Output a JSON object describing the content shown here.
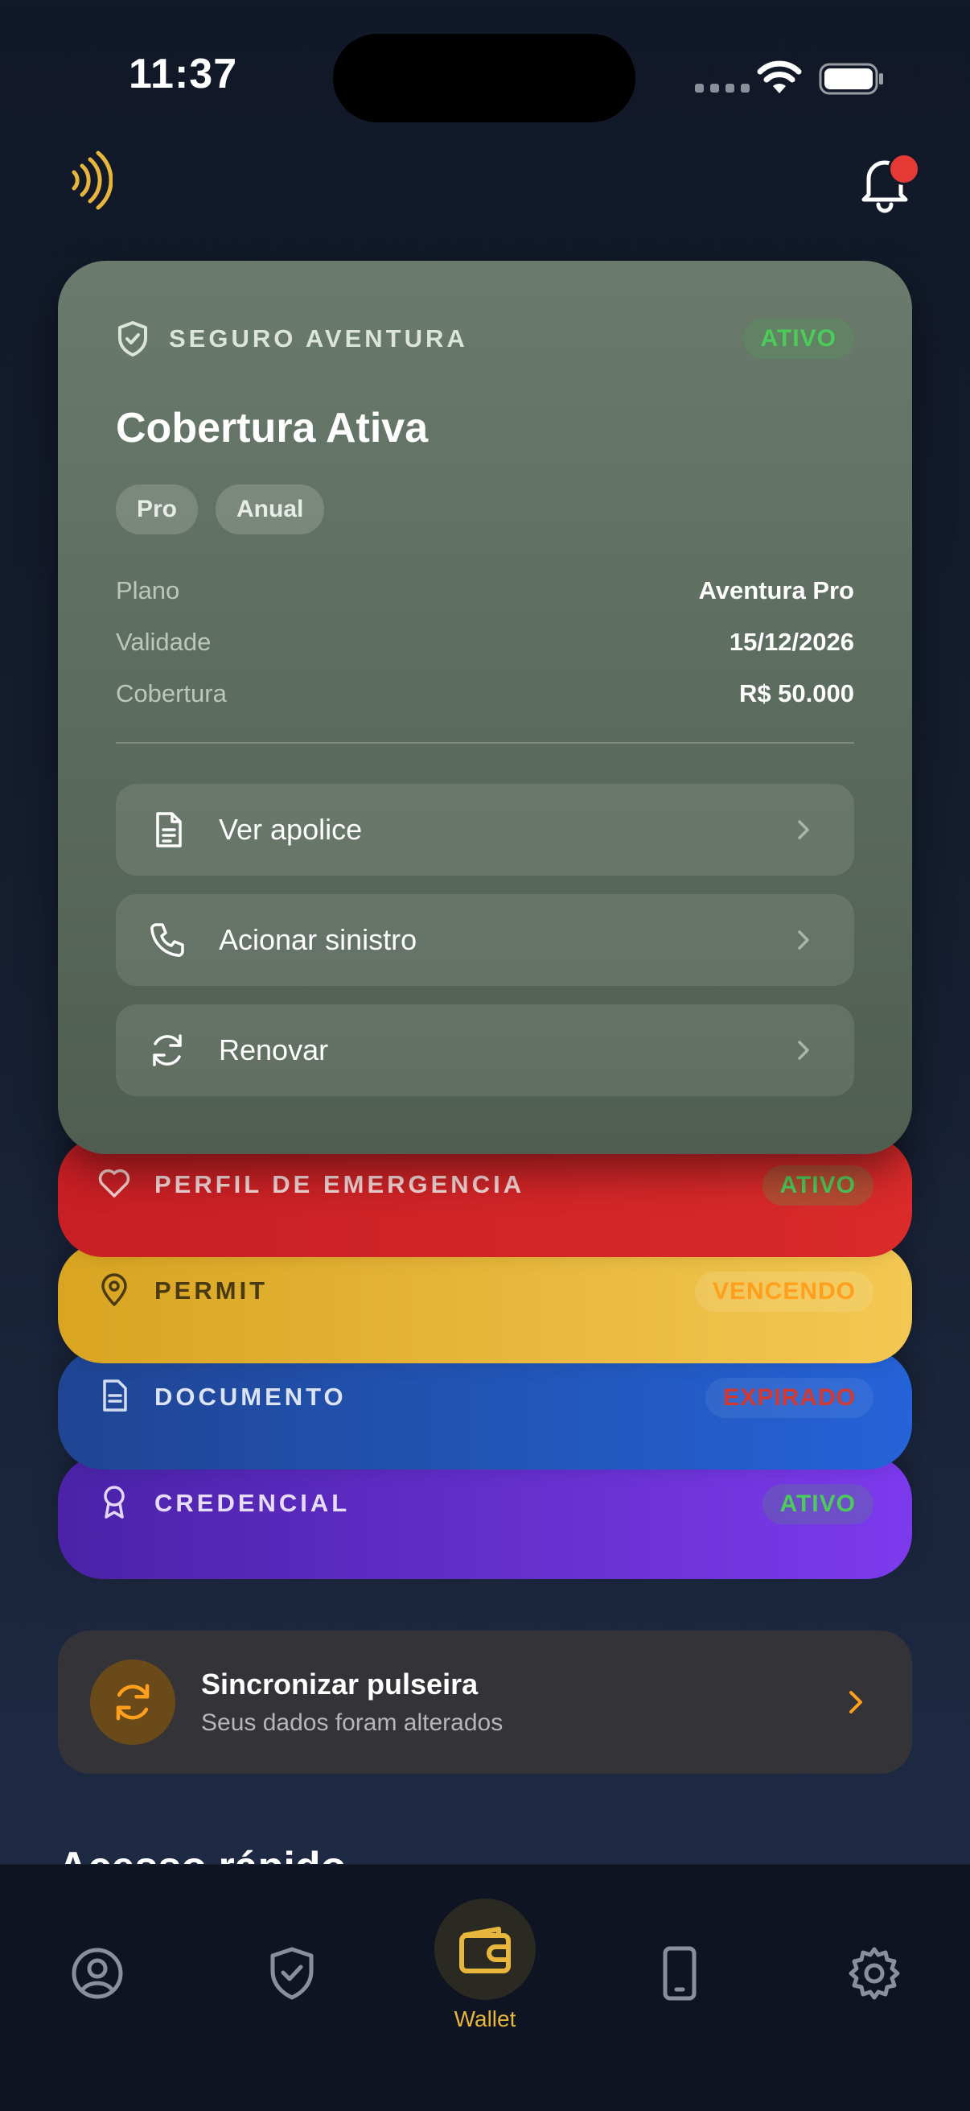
{
  "status_bar": {
    "time": "11:37"
  },
  "main_card": {
    "label": "SEGURO AVENTURA",
    "status": "ATIVO",
    "title": "Cobertura Ativa",
    "chips": [
      "Pro",
      "Anual"
    ],
    "details": [
      {
        "key": "Plano",
        "value": "Aventura Pro"
      },
      {
        "key": "Validade",
        "value": "15/12/2026"
      },
      {
        "key": "Cobertura",
        "value": "R$ 50.000"
      }
    ],
    "actions": [
      {
        "label": "Ver apolice",
        "icon": "document-icon"
      },
      {
        "label": "Acionar sinistro",
        "icon": "phone-icon"
      },
      {
        "label": "Renovar",
        "icon": "refresh-icon"
      }
    ]
  },
  "stack_cards": [
    {
      "label": "PERFIL DE EMERGENCIA",
      "status": "ATIVO",
      "icon": "heart-icon",
      "color": "#d42525"
    },
    {
      "label": "PERMIT",
      "status": "VENCENDO",
      "icon": "map-pin-icon",
      "color": "#e6b43a"
    },
    {
      "label": "DOCUMENTO",
      "status": "EXPIRADO",
      "icon": "document-icon",
      "color": "#2154b8"
    },
    {
      "label": "CREDENCIAL",
      "status": "ATIVO",
      "icon": "award-icon",
      "color": "#6330c9"
    }
  ],
  "sync_banner": {
    "title": "Sincronizar pulseira",
    "subtitle": "Seus dados foram alterados"
  },
  "section_peek": "Acesso rápido",
  "tab_bar": {
    "active_label": "Wallet",
    "tabs": [
      "profile-icon",
      "shield-check-icon",
      "wallet-icon",
      "phone-device-icon",
      "gear-icon"
    ]
  },
  "colors": {
    "accent": "#e8b63a",
    "green": "#4ccb5a",
    "orange": "#ff9f1c"
  }
}
